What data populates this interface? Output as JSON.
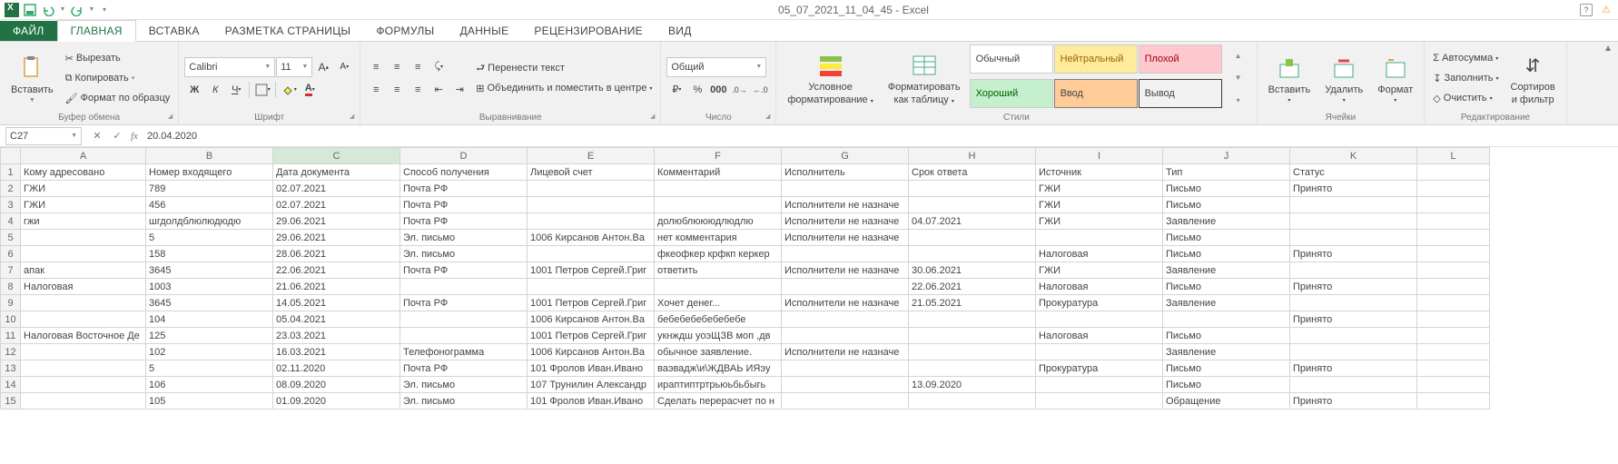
{
  "qat": {
    "save": "Сохранить",
    "undo": "Отменить",
    "redo": "Вернуть"
  },
  "title": "05_07_2021_11_04_45 - Excel",
  "tabs": {
    "file": "ФАЙЛ",
    "home": "ГЛАВНАЯ",
    "insert": "ВСТАВКА",
    "layout": "РАЗМЕТКА СТРАНИЦЫ",
    "formulas": "ФОРМУЛЫ",
    "data": "ДАННЫЕ",
    "review": "РЕЦЕНЗИРОВАНИЕ",
    "view": "ВИД"
  },
  "ribbon": {
    "clipboard": {
      "title": "Буфер обмена",
      "paste": "Вставить",
      "cut": "Вырезать",
      "copy": "Копировать",
      "fmt_painter": "Формат по образцу"
    },
    "font": {
      "title": "Шрифт",
      "name": "Calibri",
      "size": "11"
    },
    "alignment": {
      "title": "Выравнивание",
      "wrap": "Перенести текст",
      "merge": "Объединить и поместить в центре"
    },
    "number": {
      "title": "Число",
      "format": "Общий"
    },
    "styles": {
      "title": "Стили",
      "cond": "Условное",
      "cond2": "форматирование",
      "fmt_tbl": "Форматировать",
      "fmt_tbl2": "как таблицу",
      "normal": "Обычный",
      "neutral": "Нейтральный",
      "bad": "Плохой",
      "good": "Хороший",
      "input": "Ввод",
      "output": "Вывод"
    },
    "cells": {
      "title": "Ячейки",
      "insert": "Вставить",
      "delete": "Удалить",
      "format": "Формат"
    },
    "editing": {
      "title": "Редактирование",
      "sum": "Автосумма",
      "fill": "Заполнить",
      "clear": "Очистить",
      "sort": "Сортиров",
      "sort2": "и фильтр"
    }
  },
  "namebox": "C27",
  "formula": "20.04.2020",
  "columns": [
    "A",
    "B",
    "C",
    "D",
    "E",
    "F",
    "G",
    "H",
    "I",
    "J",
    "K",
    "L"
  ],
  "headers": [
    "Кому адресовано",
    "Номер входящего",
    "Дата документа",
    "Способ получения",
    "Лицевой счет",
    "Комментарий",
    "Исполнитель",
    "Срок ответа",
    "Источник",
    "Тип",
    "Статус",
    ""
  ],
  "rows": [
    [
      "ГЖИ",
      "789",
      "02.07.2021",
      "Почта РФ",
      "",
      "",
      "",
      "",
      "ГЖИ",
      "Письмо",
      "Принято",
      ""
    ],
    [
      "ГЖИ",
      "456",
      "02.07.2021",
      "Почта РФ",
      "",
      "",
      "Исполнители не назначе",
      "",
      "ГЖИ",
      "Письмо",
      "",
      ""
    ],
    [
      "гжи",
      "шгдолдблюлюдюдю",
      "29.06.2021",
      "Почта РФ",
      "",
      "долюблюююдлюдлю",
      "Исполнители не назначе",
      "04.07.2021",
      "ГЖИ",
      "Заявление",
      "",
      ""
    ],
    [
      "",
      "5",
      "29.06.2021",
      "Эл. письмо",
      "1006 Кирсанов Антон.Ва",
      "нет комментария",
      "Исполнители не назначе",
      "",
      "",
      "Письмо",
      "",
      ""
    ],
    [
      "",
      "158",
      "28.06.2021",
      "Эл. письмо",
      "",
      "фкеофкер крфкп керкер",
      "",
      "",
      "Налоговая",
      "Письмо",
      "Принято",
      ""
    ],
    [
      "апак",
      "3645",
      "22.06.2021",
      "Почта РФ",
      "1001 Петров Сергей.Григ",
      "ответить",
      "Исполнители не назначе",
      "30.06.2021",
      "ГЖИ",
      "Заявление",
      "",
      ""
    ],
    [
      "Налоговая",
      "1003",
      "21.06.2021",
      "",
      "",
      "",
      "",
      "22.06.2021",
      "Налоговая",
      "Письмо",
      "Принято",
      ""
    ],
    [
      "",
      "3645",
      "14.05.2021",
      "Почта РФ",
      "1001 Петров Сергей.Григ",
      "Хочет денег...",
      "Исполнители не назначе",
      "21.05.2021",
      "Прокуратура",
      "Заявление",
      "",
      ""
    ],
    [
      "",
      "104",
      "05.04.2021",
      "",
      "1006 Кирсанов Антон.Ва",
      "бебебебебебебебе",
      "",
      "",
      "",
      "",
      "Принято",
      ""
    ],
    [
      "Налоговая Восточное Де",
      "125",
      "23.03.2021",
      "",
      "1001 Петров Сергей.Григ",
      "укнждш уоэЩЗВ моп ,дв",
      "",
      "",
      "Налоговая",
      "Письмо",
      "",
      ""
    ],
    [
      "",
      "102",
      "16.03.2021",
      "Телефонограмма",
      "1006 Кирсанов Антон.Ва",
      "обычное заявление.",
      "Исполнители не назначе",
      "",
      "",
      "Заявление",
      "",
      ""
    ],
    [
      "",
      "5",
      "02.11.2020",
      "Почта РФ",
      "101 Фролов Иван.Ивано",
      "ваэвадж\\и\\ЖДВАЬ ИЯэу",
      "",
      "",
      "Прокуратура",
      "Письмо",
      "Принято",
      ""
    ],
    [
      "",
      "106",
      "08.09.2020",
      "Эл. письмо",
      "107 Трунилин Александр",
      "ираптиптртрьюьбьбыгь",
      "",
      "13.09.2020",
      "",
      "Письмо",
      "",
      ""
    ],
    [
      "",
      "105",
      "01.09.2020",
      "Эл. письмо",
      "101 Фролов Иван.Ивано",
      "Сделать перерасчет по н",
      "",
      "",
      "",
      "Обращение",
      "Принято",
      ""
    ]
  ]
}
